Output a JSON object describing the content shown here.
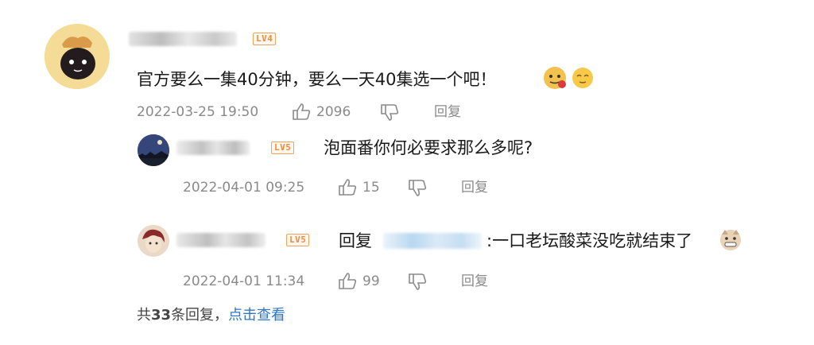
{
  "comment": {
    "level": "LV4",
    "text": "官方要么一集40分钟，要么一天40集选一个吧！",
    "emojis": [
      "doge-with-flower-emoji",
      "sleepy-smile-emoji"
    ],
    "date": "2022-03-25 19:50",
    "likes": "2096",
    "reply_label": "回复"
  },
  "replies": [
    {
      "level": "LV5",
      "text": "泡面番你何必要求那么多呢?",
      "date": "2022-04-01 09:25",
      "likes": "15",
      "reply_label": "回复"
    },
    {
      "level": "LV5",
      "prefix": "回复",
      "text": ":一口老坛酸菜没吃就结束了",
      "emoji": "grin-dog-emoji",
      "date": "2022-04-01 11:34",
      "likes": "99",
      "reply_label": "回复"
    }
  ],
  "footer": {
    "prefix": "共",
    "count": "33",
    "suffix": "条回复，",
    "link": "点击查看"
  },
  "colors": {
    "accent_link": "#2f76c8",
    "level_badge": "#f08a3c",
    "meta_text": "#8a8a8a"
  }
}
